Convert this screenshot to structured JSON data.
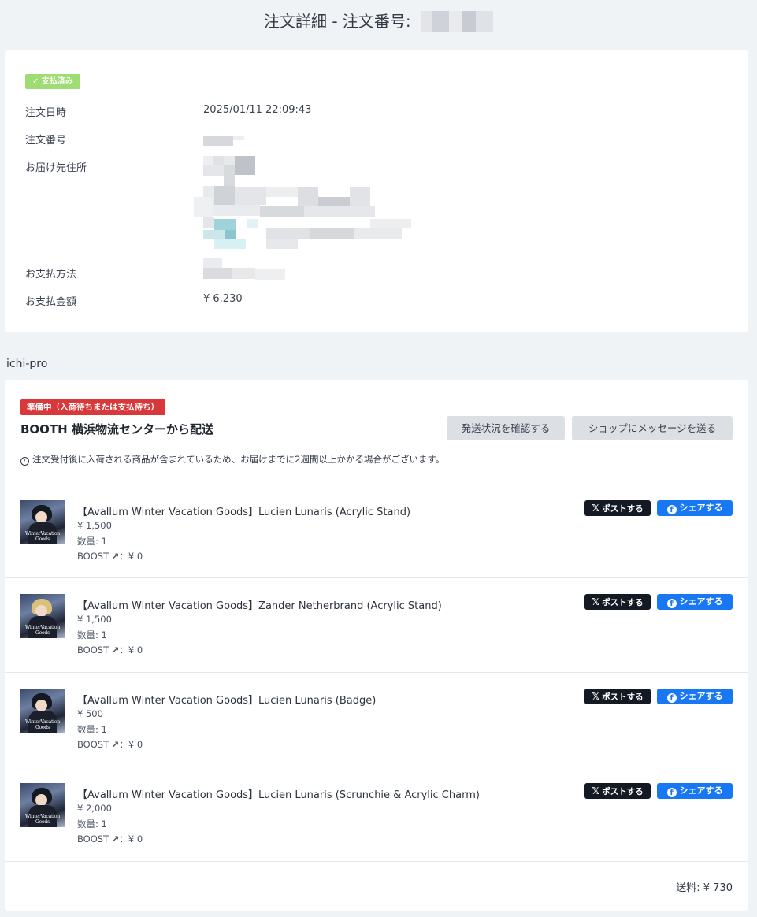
{
  "page": {
    "title": "注文詳細 - 注文番号:"
  },
  "order": {
    "status_badge": "✓ 支払済み",
    "rows": [
      {
        "label": "注文日時",
        "value": "2025/01/11 22:09:43"
      },
      {
        "label": "注文番号",
        "value": ""
      },
      {
        "label": "お届け先住所",
        "value": ""
      },
      {
        "label": "お支払方法",
        "value": ""
      },
      {
        "label": "お支払金額",
        "value": "¥ 6,230"
      }
    ]
  },
  "shop": {
    "name": "ichi-pro",
    "status_badge": "準備中（入荷待ちまたは支払待ち）",
    "ship_from": "BOOTH 横浜物流センターから配送",
    "check_shipping_button": "発送状況を確認する",
    "message_button": "ショップにメッセージを送る",
    "notice_icon": "!",
    "notice": "注文受付後に入荷される商品が含まれているため、お届けまでに2週間以上かかる場合がございます。",
    "share_x_label": "ポストする",
    "share_x_icon": "x-logo-icon",
    "share_fb_label": "シェアする",
    "share_fb_icon": "facebook-icon",
    "thumb_caption": "WinterVacation Goods",
    "boost_label": "BOOST",
    "items": [
      {
        "title": "【Avallum Winter Vacation Goods】Lucien Lunaris (Acrylic Stand)",
        "price": "¥ 1,500",
        "quantity": "数量: 1",
        "boost": "：¥ 0"
      },
      {
        "title": "【Avallum Winter Vacation Goods】Zander Netherbrand (Acrylic Stand)",
        "price": "¥ 1,500",
        "quantity": "数量: 1",
        "boost": "：¥ 0"
      },
      {
        "title": "【Avallum Winter Vacation Goods】Lucien Lunaris (Badge)",
        "price": "¥ 500",
        "quantity": "数量: 1",
        "boost": "：¥ 0"
      },
      {
        "title": "【Avallum Winter Vacation Goods】Lucien Lunaris (Scrunchie & Acrylic Charm)",
        "price": "¥ 2,000",
        "quantity": "数量: 1",
        "boost": "：¥ 0"
      }
    ],
    "shipping_fee": "送料: ¥ 730"
  },
  "colors": {
    "background": "#f0f3f6",
    "paid_badge": "#9fdc73",
    "status_badge": "#d9383a",
    "x_button": "#141a24",
    "facebook_button": "#1877f2",
    "gray_button": "#dcdfe4"
  }
}
